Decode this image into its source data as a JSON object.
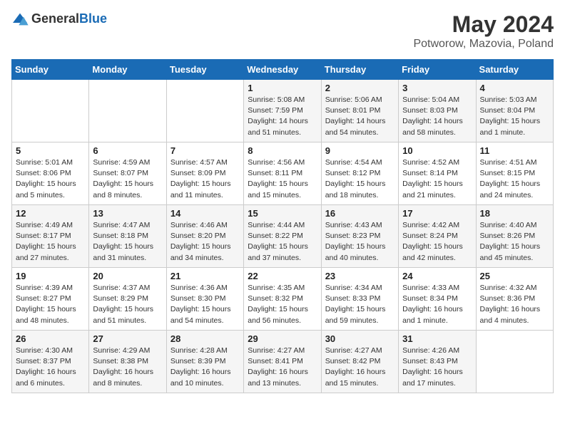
{
  "header": {
    "logo_general": "General",
    "logo_blue": "Blue",
    "title": "May 2024",
    "subtitle": "Potworow, Mazovia, Poland"
  },
  "columns": [
    "Sunday",
    "Monday",
    "Tuesday",
    "Wednesday",
    "Thursday",
    "Friday",
    "Saturday"
  ],
  "weeks": [
    [
      {
        "day": "",
        "info": ""
      },
      {
        "day": "",
        "info": ""
      },
      {
        "day": "",
        "info": ""
      },
      {
        "day": "1",
        "info": "Sunrise: 5:08 AM\nSunset: 7:59 PM\nDaylight: 14 hours\nand 51 minutes."
      },
      {
        "day": "2",
        "info": "Sunrise: 5:06 AM\nSunset: 8:01 PM\nDaylight: 14 hours\nand 54 minutes."
      },
      {
        "day": "3",
        "info": "Sunrise: 5:04 AM\nSunset: 8:03 PM\nDaylight: 14 hours\nand 58 minutes."
      },
      {
        "day": "4",
        "info": "Sunrise: 5:03 AM\nSunset: 8:04 PM\nDaylight: 15 hours\nand 1 minute."
      }
    ],
    [
      {
        "day": "5",
        "info": "Sunrise: 5:01 AM\nSunset: 8:06 PM\nDaylight: 15 hours\nand 5 minutes."
      },
      {
        "day": "6",
        "info": "Sunrise: 4:59 AM\nSunset: 8:07 PM\nDaylight: 15 hours\nand 8 minutes."
      },
      {
        "day": "7",
        "info": "Sunrise: 4:57 AM\nSunset: 8:09 PM\nDaylight: 15 hours\nand 11 minutes."
      },
      {
        "day": "8",
        "info": "Sunrise: 4:56 AM\nSunset: 8:11 PM\nDaylight: 15 hours\nand 15 minutes."
      },
      {
        "day": "9",
        "info": "Sunrise: 4:54 AM\nSunset: 8:12 PM\nDaylight: 15 hours\nand 18 minutes."
      },
      {
        "day": "10",
        "info": "Sunrise: 4:52 AM\nSunset: 8:14 PM\nDaylight: 15 hours\nand 21 minutes."
      },
      {
        "day": "11",
        "info": "Sunrise: 4:51 AM\nSunset: 8:15 PM\nDaylight: 15 hours\nand 24 minutes."
      }
    ],
    [
      {
        "day": "12",
        "info": "Sunrise: 4:49 AM\nSunset: 8:17 PM\nDaylight: 15 hours\nand 27 minutes."
      },
      {
        "day": "13",
        "info": "Sunrise: 4:47 AM\nSunset: 8:18 PM\nDaylight: 15 hours\nand 31 minutes."
      },
      {
        "day": "14",
        "info": "Sunrise: 4:46 AM\nSunset: 8:20 PM\nDaylight: 15 hours\nand 34 minutes."
      },
      {
        "day": "15",
        "info": "Sunrise: 4:44 AM\nSunset: 8:22 PM\nDaylight: 15 hours\nand 37 minutes."
      },
      {
        "day": "16",
        "info": "Sunrise: 4:43 AM\nSunset: 8:23 PM\nDaylight: 15 hours\nand 40 minutes."
      },
      {
        "day": "17",
        "info": "Sunrise: 4:42 AM\nSunset: 8:24 PM\nDaylight: 15 hours\nand 42 minutes."
      },
      {
        "day": "18",
        "info": "Sunrise: 4:40 AM\nSunset: 8:26 PM\nDaylight: 15 hours\nand 45 minutes."
      }
    ],
    [
      {
        "day": "19",
        "info": "Sunrise: 4:39 AM\nSunset: 8:27 PM\nDaylight: 15 hours\nand 48 minutes."
      },
      {
        "day": "20",
        "info": "Sunrise: 4:37 AM\nSunset: 8:29 PM\nDaylight: 15 hours\nand 51 minutes."
      },
      {
        "day": "21",
        "info": "Sunrise: 4:36 AM\nSunset: 8:30 PM\nDaylight: 15 hours\nand 54 minutes."
      },
      {
        "day": "22",
        "info": "Sunrise: 4:35 AM\nSunset: 8:32 PM\nDaylight: 15 hours\nand 56 minutes."
      },
      {
        "day": "23",
        "info": "Sunrise: 4:34 AM\nSunset: 8:33 PM\nDaylight: 15 hours\nand 59 minutes."
      },
      {
        "day": "24",
        "info": "Sunrise: 4:33 AM\nSunset: 8:34 PM\nDaylight: 16 hours\nand 1 minute."
      },
      {
        "day": "25",
        "info": "Sunrise: 4:32 AM\nSunset: 8:36 PM\nDaylight: 16 hours\nand 4 minutes."
      }
    ],
    [
      {
        "day": "26",
        "info": "Sunrise: 4:30 AM\nSunset: 8:37 PM\nDaylight: 16 hours\nand 6 minutes."
      },
      {
        "day": "27",
        "info": "Sunrise: 4:29 AM\nSunset: 8:38 PM\nDaylight: 16 hours\nand 8 minutes."
      },
      {
        "day": "28",
        "info": "Sunrise: 4:28 AM\nSunset: 8:39 PM\nDaylight: 16 hours\nand 10 minutes."
      },
      {
        "day": "29",
        "info": "Sunrise: 4:27 AM\nSunset: 8:41 PM\nDaylight: 16 hours\nand 13 minutes."
      },
      {
        "day": "30",
        "info": "Sunrise: 4:27 AM\nSunset: 8:42 PM\nDaylight: 16 hours\nand 15 minutes."
      },
      {
        "day": "31",
        "info": "Sunrise: 4:26 AM\nSunset: 8:43 PM\nDaylight: 16 hours\nand 17 minutes."
      },
      {
        "day": "",
        "info": ""
      }
    ]
  ]
}
